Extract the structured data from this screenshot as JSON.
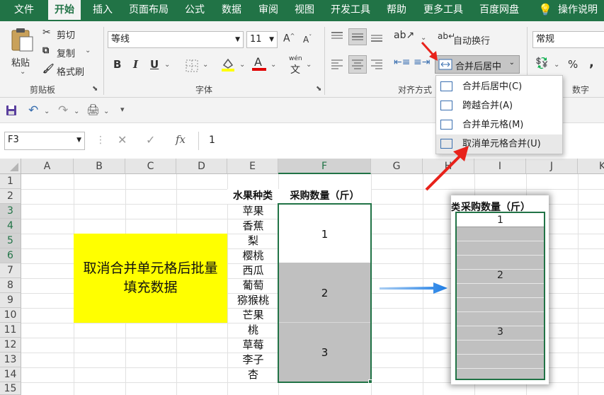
{
  "tabs": [
    "文件",
    "开始",
    "插入",
    "页面布局",
    "公式",
    "数据",
    "审阅",
    "视图",
    "开发工具",
    "帮助",
    "更多工具",
    "百度网盘",
    "操作说明搜"
  ],
  "ribbon": {
    "clipboard": {
      "paste": "粘贴",
      "cut": "剪切",
      "copy": "复制",
      "format_painter": "格式刷",
      "group_label": "剪贴板"
    },
    "font": {
      "font_name": "等线",
      "font_size": "11",
      "bold": "B",
      "italic": "I",
      "underline": "U",
      "wen": "wén",
      "wen_char": "文",
      "group_label": "字体"
    },
    "alignment": {
      "wrap_text": "自动换行",
      "merge_center": "合并后居中",
      "group_label": "对齐方式"
    },
    "number": {
      "format": "常规",
      "percent": "%",
      "group_label": "数字"
    }
  },
  "merge_menu": {
    "items": [
      {
        "label": "合并后居中(C)"
      },
      {
        "label": "跨越合并(A)"
      },
      {
        "label": "合并单元格(M)"
      },
      {
        "label": "取消单元格合并(U)"
      }
    ]
  },
  "formula_bar": {
    "name_box": "F3",
    "fx": "fx",
    "value": "1"
  },
  "sheet": {
    "columns": [
      "A",
      "B",
      "C",
      "D",
      "E",
      "F",
      "G",
      "H",
      "I",
      "J",
      "K"
    ],
    "rows": [
      "1",
      "2",
      "3",
      "4",
      "5",
      "6",
      "7",
      "8",
      "9",
      "10",
      "11",
      "12",
      "13",
      "14",
      "15"
    ],
    "header_e": "水果种类",
    "header_f": "采购数量（斤）",
    "fruits": [
      "苹果",
      "香蕉",
      "梨",
      "樱桃",
      "西瓜",
      "葡萄",
      "猕猴桃",
      "芒果",
      "桃",
      "草莓",
      "李子",
      "杏"
    ],
    "merged_values": [
      "1",
      "2",
      "3"
    ],
    "note": "取消合并单元格后批量填充数据",
    "note_bg": "#ffff00",
    "merged_fill": "#c0c0c0",
    "accent": "#217346"
  },
  "inset": {
    "header": "采购数量（斤）",
    "values": [
      "1",
      "2",
      "3"
    ],
    "partial_char": "类"
  }
}
